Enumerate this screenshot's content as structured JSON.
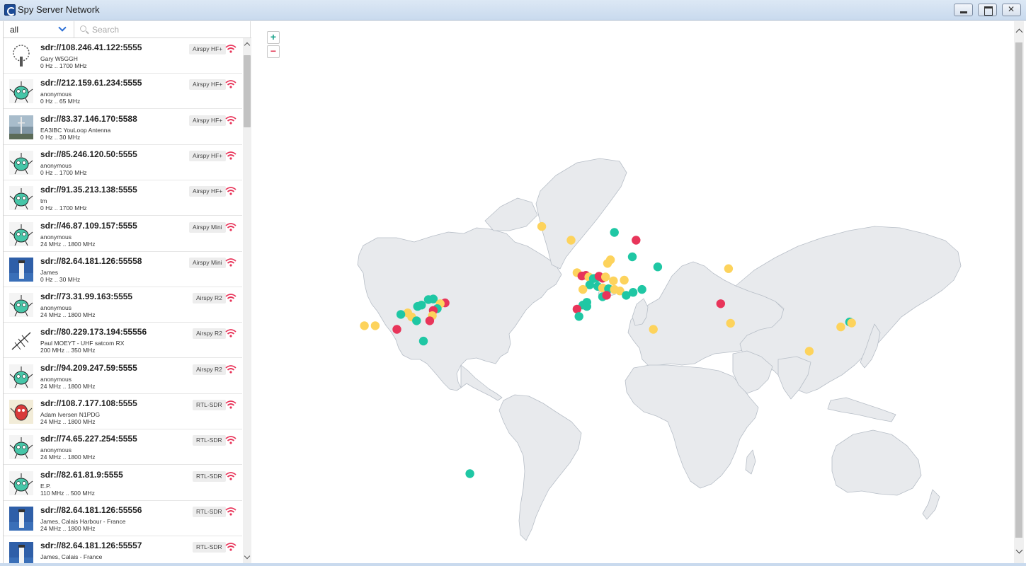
{
  "window": {
    "title": "Spy Server Network",
    "icon": "spy-server-app-icon",
    "controls": [
      "minimize-icon",
      "maximize-icon",
      "close-icon"
    ]
  },
  "filter": {
    "selected": "all"
  },
  "search": {
    "placeholder": "Search",
    "value": ""
  },
  "colors": {
    "online_green": "#1fc7a4",
    "busy_red": "#e8355a",
    "idle_yellow": "#fdd35c",
    "land": "#e8eaed",
    "border": "#b7bec7",
    "wifi": "#e8355a",
    "badge_bg": "#ededed"
  },
  "servers": [
    {
      "url": "sdr://108.246.41.122:5555",
      "owner": "Gary W5GGH",
      "range": "0 Hz .. 1700 MHz",
      "device": "Airspy HF+",
      "avatar": "tree-avatar"
    },
    {
      "url": "sdr://212.159.61.234:5555",
      "owner": "anonymous",
      "range": "0 Hz .. 65 MHz",
      "device": "Airspy HF+",
      "avatar": "spy-mascot-avatar"
    },
    {
      "url": "sdr://83.37.146.170:5588",
      "owner": "EA3IBC YouLoop Antenna",
      "range": "0 Hz .. 30 MHz",
      "device": "Airspy HF+",
      "avatar": "antenna-mast-avatar"
    },
    {
      "url": "sdr://85.246.120.50:5555",
      "owner": "anonymous",
      "range": "0 Hz .. 1700 MHz",
      "device": "Airspy HF+",
      "avatar": "spy-mascot-avatar"
    },
    {
      "url": "sdr://91.35.213.138:5555",
      "owner": "tm",
      "range": "0 Hz .. 1700 MHz",
      "device": "Airspy HF+",
      "avatar": "spy-mascot-avatar"
    },
    {
      "url": "sdr://46.87.109.157:5555",
      "owner": "anonymous",
      "range": "24 MHz .. 1800 MHz",
      "device": "Airspy Mini",
      "avatar": "spy-mascot-avatar"
    },
    {
      "url": "sdr://82.64.181.126:55558",
      "owner": "James",
      "range": "0 Hz .. 30 MHz",
      "device": "Airspy Mini",
      "avatar": "lighthouse-avatar"
    },
    {
      "url": "sdr://73.31.99.163:5555",
      "owner": "anonymous",
      "range": "24 MHz .. 1800 MHz",
      "device": "Airspy R2",
      "avatar": "spy-mascot-avatar"
    },
    {
      "url": "sdr://80.229.173.194:55556",
      "owner": "Paul MOEYT - UHF satcom RX",
      "range": "200 MHz .. 350 MHz",
      "device": "Airspy R2",
      "avatar": "yagi-antenna-avatar"
    },
    {
      "url": "sdr://94.209.247.59:5555",
      "owner": "anonymous",
      "range": "24 MHz .. 1800 MHz",
      "device": "Airspy R2",
      "avatar": "spy-mascot-avatar"
    },
    {
      "url": "sdr://108.7.177.108:5555",
      "owner": "Adam Iversen N1PDG",
      "range": "24 MHz .. 1800 MHz",
      "device": "RTL-SDR",
      "avatar": "red-mascot-avatar"
    },
    {
      "url": "sdr://74.65.227.254:5555",
      "owner": "anonymous",
      "range": "24 MHz .. 1800 MHz",
      "device": "RTL-SDR",
      "avatar": "spy-mascot-avatar"
    },
    {
      "url": "sdr://82.61.81.9:5555",
      "owner": "E.P.",
      "range": "110 MHz .. 500 MHz",
      "device": "RTL-SDR",
      "avatar": "spy-mascot-avatar"
    },
    {
      "url": "sdr://82.64.181.126:55556",
      "owner": "James, Calais Harbour - France",
      "range": "24 MHz .. 1800 MHz",
      "device": "RTL-SDR",
      "avatar": "lighthouse-avatar"
    },
    {
      "url": "sdr://82.64.181.126:55557",
      "owner": "James, Calais - France",
      "range": "",
      "device": "RTL-SDR",
      "avatar": "lighthouse-avatar"
    }
  ],
  "map": {
    "zoom_in_label": "+",
    "zoom_out_label": "−",
    "markers": [
      {
        "lat": 64.1,
        "lon": -21.9,
        "status": "idle"
      },
      {
        "lat": 61.0,
        "lon": -7.0,
        "status": "idle"
      },
      {
        "lat": 62.8,
        "lon": 15.0,
        "status": "online"
      },
      {
        "lat": 61.0,
        "lon": 26.0,
        "status": "busy"
      },
      {
        "lat": 56.8,
        "lon": 24.1,
        "status": "online"
      },
      {
        "lat": 56.0,
        "lon": 13.0,
        "status": "idle"
      },
      {
        "lat": 55.0,
        "lon": 11.5,
        "status": "idle"
      },
      {
        "lat": 54.0,
        "lon": 37.0,
        "status": "online"
      },
      {
        "lat": 53.5,
        "lon": 73.0,
        "status": "idle"
      },
      {
        "lat": 52.3,
        "lon": -4.0,
        "status": "idle"
      },
      {
        "lat": 51.3,
        "lon": -1.5,
        "status": "busy"
      },
      {
        "lat": 51.5,
        "lon": 0.5,
        "status": "busy"
      },
      {
        "lat": 51.0,
        "lon": 2.0,
        "status": "idle"
      },
      {
        "lat": 50.5,
        "lon": 4.3,
        "status": "online"
      },
      {
        "lat": 50.7,
        "lon": 6.0,
        "status": "online"
      },
      {
        "lat": 51.2,
        "lon": 7.2,
        "status": "busy"
      },
      {
        "lat": 50.6,
        "lon": 9.0,
        "status": "busy"
      },
      {
        "lat": 51.0,
        "lon": 10.5,
        "status": "idle"
      },
      {
        "lat": 50.0,
        "lon": 20.0,
        "status": "idle"
      },
      {
        "lat": 49.8,
        "lon": 14.5,
        "status": "idle"
      },
      {
        "lat": 48.5,
        "lon": 2.5,
        "status": "online"
      },
      {
        "lat": 48.0,
        "lon": 6.5,
        "status": "online"
      },
      {
        "lat": 47.5,
        "lon": 9.0,
        "status": "idle"
      },
      {
        "lat": 47.2,
        "lon": 12.0,
        "status": "online"
      },
      {
        "lat": 47.0,
        "lon": 15.0,
        "status": "idle"
      },
      {
        "lat": 46.5,
        "lon": 17.8,
        "status": "idle"
      },
      {
        "lat": 47.0,
        "lon": 29.0,
        "status": "online"
      },
      {
        "lat": 46.0,
        "lon": 24.5,
        "status": "online"
      },
      {
        "lat": 45.0,
        "lon": 21.0,
        "status": "online"
      },
      {
        "lat": 44.5,
        "lon": 9.0,
        "status": "online"
      },
      {
        "lat": 45.0,
        "lon": 11.0,
        "status": "busy"
      },
      {
        "lat": 47.0,
        "lon": -1.0,
        "status": "idle"
      },
      {
        "lat": 41.0,
        "lon": 1.0,
        "status": "online"
      },
      {
        "lat": 42.5,
        "lon": 1.0,
        "status": "online"
      },
      {
        "lat": 41.5,
        "lon": -1.0,
        "status": "online"
      },
      {
        "lat": 40.0,
        "lon": -4.0,
        "status": "busy"
      },
      {
        "lat": 37.2,
        "lon": -3.0,
        "status": "online"
      },
      {
        "lat": 32.0,
        "lon": 34.8,
        "status": "idle"
      },
      {
        "lat": 42.0,
        "lon": 69.0,
        "status": "busy"
      },
      {
        "lat": 34.5,
        "lon": 74.0,
        "status": "idle"
      },
      {
        "lat": 22.5,
        "lon": 114.0,
        "status": "idle"
      },
      {
        "lat": 33.0,
        "lon": 130.0,
        "status": "idle"
      },
      {
        "lat": 35.0,
        "lon": 134.5,
        "status": "online"
      },
      {
        "lat": 34.6,
        "lon": 135.5,
        "status": "idle"
      },
      {
        "lat": 43.5,
        "lon": -79.5,
        "status": "online"
      },
      {
        "lat": 43.7,
        "lon": -77.0,
        "status": "online"
      },
      {
        "lat": 42.3,
        "lon": -71.0,
        "status": "busy"
      },
      {
        "lat": 42.0,
        "lon": -73.5,
        "status": "idle"
      },
      {
        "lat": 41.5,
        "lon": -83.0,
        "status": "online"
      },
      {
        "lat": 41.0,
        "lon": -85.0,
        "status": "online"
      },
      {
        "lat": 40.2,
        "lon": -75.0,
        "status": "online"
      },
      {
        "lat": 39.5,
        "lon": -77.0,
        "status": "busy"
      },
      {
        "lat": 37.5,
        "lon": -77.5,
        "status": "idle"
      },
      {
        "lat": 38.6,
        "lon": -90.0,
        "status": "idle"
      },
      {
        "lat": 38.0,
        "lon": -93.5,
        "status": "online"
      },
      {
        "lat": 37.0,
        "lon": -88.0,
        "status": "idle"
      },
      {
        "lat": 35.5,
        "lon": -78.8,
        "status": "busy"
      },
      {
        "lat": 35.5,
        "lon": -85.5,
        "status": "online"
      },
      {
        "lat": 33.5,
        "lon": -112.0,
        "status": "idle"
      },
      {
        "lat": 33.5,
        "lon": -106.5,
        "status": "idle"
      },
      {
        "lat": 32.0,
        "lon": -95.5,
        "status": "busy"
      },
      {
        "lat": 27.0,
        "lon": -82.0,
        "status": "online"
      },
      {
        "lat": -34.6,
        "lon": -58.4,
        "status": "online"
      }
    ]
  }
}
